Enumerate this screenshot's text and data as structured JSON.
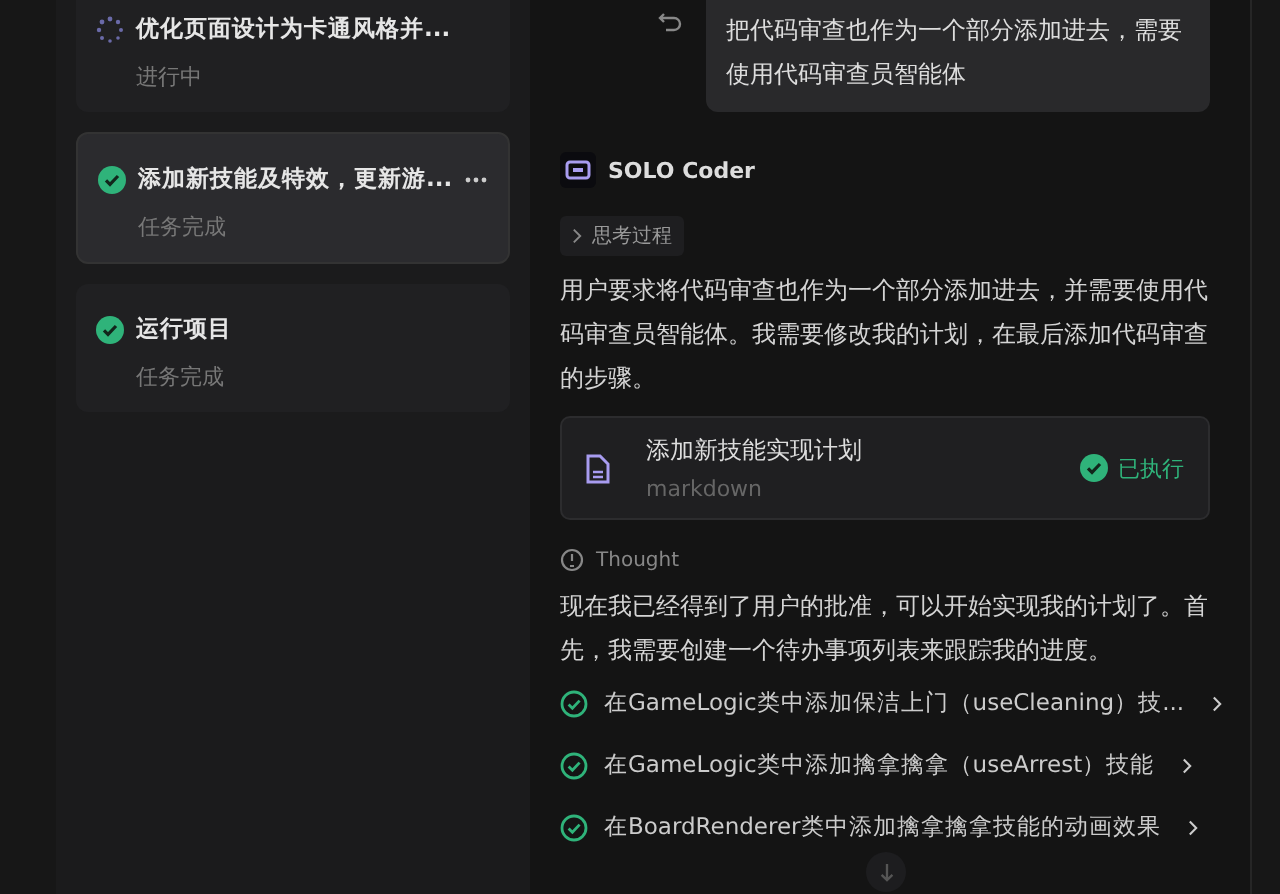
{
  "tasks": [
    {
      "title": "优化页面设计为卡通风格并...",
      "status_text": "进行中",
      "kind": "running",
      "selected": false,
      "more": false
    },
    {
      "title": "添加新技能及特效，更新游...",
      "status_text": "任务完成",
      "kind": "done",
      "selected": true,
      "more": true
    },
    {
      "title": "运行项目",
      "status_text": "任务完成",
      "kind": "done",
      "selected": false,
      "more": false
    }
  ],
  "chat": {
    "user_message": "把代码审查也作为一个部分添加进去，需要使用代码审查员智能体",
    "agent_name": "SOLO Coder",
    "thinking_label": "思考过程",
    "reply": "用户要求将代码审查也作为一个部分添加进去，并需要使用代码审查员智能体。我需要修改我的计划，在最后添加代码审查的步骤。",
    "file_card": {
      "title": "添加新技能实现计划",
      "type": "markdown",
      "status": "已执行"
    },
    "thought_label": "Thought",
    "reply2": "现在我已经得到了用户的批准，可以开始实现我的计划了。首先，我需要创建一个待办事项列表来跟踪我的进度。",
    "todos": [
      {
        "text": "在GameLogic类中添加保洁上门（useCleaning）技...",
        "done": true
      },
      {
        "text": "在GameLogic类中添加擒拿擒拿（useArrest）技能",
        "done": true
      },
      {
        "text": "在BoardRenderer类中添加擒拿擒拿技能的动画效果",
        "done": true
      }
    ]
  }
}
